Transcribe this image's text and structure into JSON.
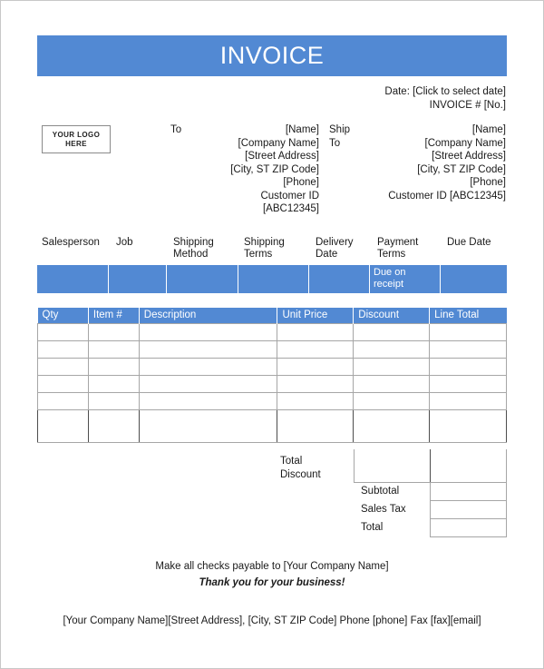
{
  "document": {
    "title": "INVOICE"
  },
  "meta": {
    "date_line": "Date: [Click to select date]",
    "invoice_number_line": "INVOICE # [No.]"
  },
  "logo": {
    "line1": "YOUR LOGO",
    "line2": "HERE"
  },
  "bill_to": {
    "label": "To",
    "lines": [
      "[Name]",
      "[Company Name]",
      "[Street Address]",
      "[City, ST  ZIP Code]",
      "[Phone]",
      "Customer ID",
      "[ABC12345]"
    ]
  },
  "ship_to": {
    "label": "Ship\nTo",
    "label_line1": "Ship",
    "label_line2": "To",
    "lines": [
      "[Name]",
      "[Company Name]",
      "[Street Address]",
      "[City, ST  ZIP Code]",
      "[Phone]",
      "Customer ID [ABC12345]"
    ]
  },
  "terms": {
    "headers": [
      "Salesperson",
      "Job",
      "Shipping Method",
      "Shipping Terms",
      "Delivery Date",
      "Payment Terms",
      "Due Date"
    ],
    "values": [
      "",
      "",
      "",
      "",
      "",
      "Due on receipt",
      ""
    ]
  },
  "items": {
    "columns": [
      "Qty",
      "Item #",
      "Description",
      "Unit Price",
      "Discount",
      "Line Total"
    ],
    "rows": [
      [
        "",
        "",
        "",
        "",
        "",
        ""
      ],
      [
        "",
        "",
        "",
        "",
        "",
        ""
      ],
      [
        "",
        "",
        "",
        "",
        "",
        ""
      ],
      [
        "",
        "",
        "",
        "",
        "",
        ""
      ],
      [
        "",
        "",
        "",
        "",
        "",
        ""
      ],
      [
        "",
        "",
        "",
        "",
        "",
        ""
      ]
    ]
  },
  "totals": {
    "total_discount_label_line1": "Total",
    "total_discount_label_line2": "Discount",
    "total_discount_value": "",
    "rows": [
      {
        "label": "Subtotal",
        "value": ""
      },
      {
        "label": "Sales Tax",
        "value": ""
      },
      {
        "label": "Total",
        "value": ""
      }
    ]
  },
  "footer": {
    "payable_to": "Make all checks payable to [Your Company Name]",
    "thank_you": "Thank you for your business!",
    "company_address": "[Your Company Name][Street Address], [City, ST  ZIP Code]  Phone [phone]  Fax [fax][email]"
  },
  "colors": {
    "accent_blue": "#5289d3",
    "grid_line": "#a6a6a6",
    "dark_line": "#4d4d4d",
    "text": "#1a1a1a"
  }
}
